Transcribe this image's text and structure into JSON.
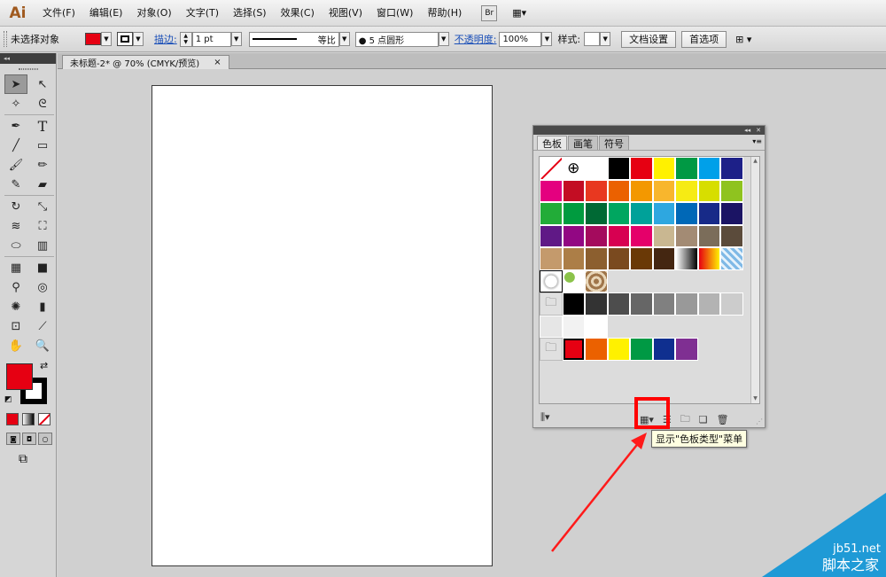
{
  "app": {
    "logo": "Ai"
  },
  "menu": [
    {
      "id": "file",
      "label": "文件(F)"
    },
    {
      "id": "edit",
      "label": "编辑(E)"
    },
    {
      "id": "object",
      "label": "对象(O)"
    },
    {
      "id": "type",
      "label": "文字(T)"
    },
    {
      "id": "select",
      "label": "选择(S)"
    },
    {
      "id": "effect",
      "label": "效果(C)"
    },
    {
      "id": "view",
      "label": "视图(V)"
    },
    {
      "id": "window",
      "label": "窗口(W)"
    },
    {
      "id": "help",
      "label": "帮助(H)"
    }
  ],
  "menubar_buttons": {
    "bridge": "Br",
    "arrange": "▦▾"
  },
  "control": {
    "selection": "未选择对象",
    "stroke_label": "描边:",
    "stroke_weight": "1 pt",
    "profile": "等比",
    "brush": "● 5 点圆形",
    "opacity_label": "不透明度:",
    "opacity": "100%",
    "style_label": "样式:",
    "doc_setup": "文档设置",
    "prefs": "首选项",
    "fill_color": "#e60012"
  },
  "document": {
    "tab_title": "未标题-2* @ 70% (CMYK/预览)",
    "close": "×"
  },
  "panel": {
    "tabs": [
      {
        "id": "swatches",
        "label": "色板"
      },
      {
        "id": "brushes",
        "label": "画笔"
      },
      {
        "id": "symbols",
        "label": "符号"
      }
    ],
    "tooltip": "显示\"色板类型\"菜单"
  },
  "swatches": {
    "row1": [
      "#ffffff",
      "#000000",
      "#e60012",
      "#fff100",
      "#009944",
      "#00a0e9",
      "#1d2088"
    ],
    "row2": [
      "#e4007f",
      "#c30d23",
      "#e83820",
      "#eb6100",
      "#f39800",
      "#f8b62d",
      "#f6eb14",
      "#d7de00",
      "#8fc31f"
    ],
    "row3": [
      "#22ac38",
      "#009b3f",
      "#006934",
      "#00a660",
      "#00a199",
      "#2ea7e0",
      "#0068b7",
      "#172a88",
      "#1b1464"
    ],
    "row4": [
      "#601986",
      "#920783",
      "#a40b5d",
      "#d70051",
      "#e5006a",
      "#c9b791",
      "#a38b74",
      "#7b6d5a",
      "#5b4b3b"
    ],
    "row5": [
      "#c49a6c",
      "#ac7e47",
      "#8c5f2f",
      "#7a4a1f",
      "#6a3906",
      "#442611"
    ],
    "grays": [
      "#000000",
      "#333333",
      "#4d4d4d",
      "#666666",
      "#808080",
      "#999999",
      "#b3b3b3",
      "#cccccc"
    ],
    "grays2": [
      "#e6e6e6",
      "#f2f2f2",
      "#ffffff"
    ],
    "brights": [
      "#e60012",
      "#eb6100",
      "#fff100",
      "#009944",
      "#0f2f8f",
      "#7f2f92"
    ]
  },
  "watermark": {
    "site": "jb51.net",
    "name": "脚本之家"
  }
}
